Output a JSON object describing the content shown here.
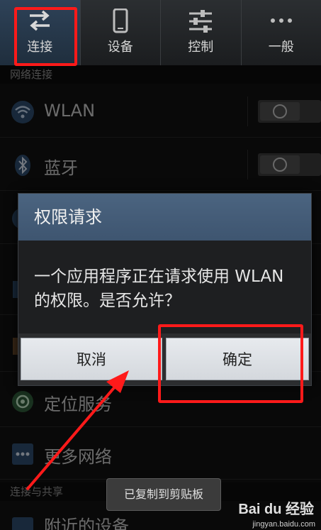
{
  "tabs": [
    {
      "label": "连接",
      "icon": "swap-arrows-icon"
    },
    {
      "label": "设备",
      "icon": "phone-icon"
    },
    {
      "label": "控制",
      "icon": "sliders-icon"
    },
    {
      "label": "一般",
      "icon": "more-dots-icon"
    }
  ],
  "sections": {
    "network": "网络连接",
    "sharing": "连接与共享"
  },
  "rows": {
    "wlan": "WLAN",
    "bluetooth": "蓝牙",
    "location": "定位服务",
    "more_networks": "更多网络",
    "nearby_devices": "附近的设备"
  },
  "dialog": {
    "title": "权限请求",
    "message": "一个应用程序正在请求使用 WLAN 的权限。是否允许？",
    "cancel": "取消",
    "ok": "确定"
  },
  "toast": "已复制到剪贴板",
  "watermark": {
    "brand": "Bai du 经验",
    "url": "jingyan.baidu.com"
  },
  "colors": {
    "annotation": "#ff1a1a",
    "dialog_title": "#4b6480",
    "active_tab": "#2e4258"
  }
}
